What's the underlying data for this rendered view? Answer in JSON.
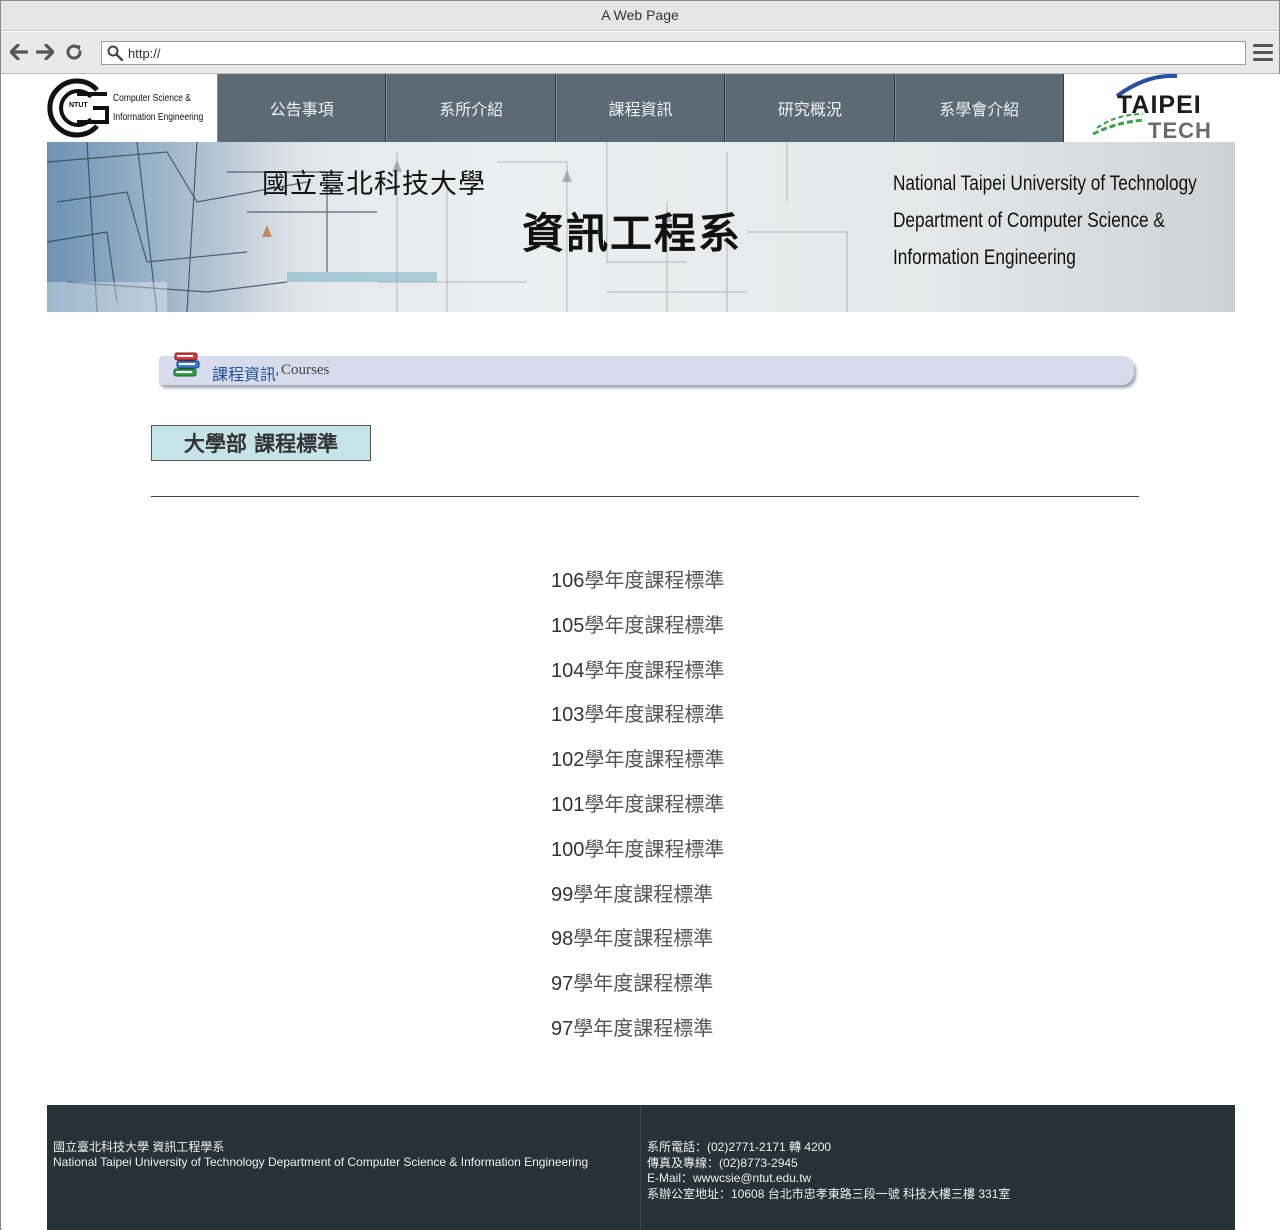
{
  "window": {
    "title": "A Web Page"
  },
  "toolbar": {
    "url": "http://"
  },
  "header": {
    "logo_line1": "Computer Science &",
    "logo_line2": "Information Engineering",
    "logo_badge": "NTUT",
    "nav": [
      "公告事項",
      "系所介紹",
      "課程資訊",
      "研究概況",
      "系學會介紹"
    ],
    "brand_top": "TAIPEI",
    "brand_bottom": "TECH"
  },
  "banner": {
    "univ_cn": "國立臺北科技大學",
    "dept_cn": "資訊工程系",
    "en_line1": "National Taipei University of Technology",
    "en_line2": "Department of Computer Science &",
    "en_line3": "Information Engineering"
  },
  "section": {
    "title_cn": "課程資訊",
    "sep": ",",
    "title_en": "Courses"
  },
  "subtitle": "大學部 課程標準",
  "courses": [
    {
      "year": "106",
      "label": "學年度課程標準"
    },
    {
      "year": "105",
      "label": "學年度課程標準"
    },
    {
      "year": "104",
      "label": "學年度課程標準"
    },
    {
      "year": "103",
      "label": "學年度課程標準"
    },
    {
      "year": "102",
      "label": "學年度課程標準"
    },
    {
      "year": "101",
      "label": "學年度課程標準"
    },
    {
      "year": "100",
      "label": "學年度課程標準"
    },
    {
      "year": "99",
      "label": "學年度課程標準"
    },
    {
      "year": "98",
      "label": "學年度課程標準"
    },
    {
      "year": "97",
      "label": "學年度課程標準"
    },
    {
      "year": "97",
      "label": "學年度課程標準"
    }
  ],
  "footer": {
    "name_cn": "國立臺北科技大學 資訊工程學系",
    "name_en": "National Taipei University of Technology Department of Computer Science & Information Engineering",
    "phone": "系所電話：(02)2771-2171 轉 4200",
    "fax": "傳真及專線：(02)8773-2945",
    "email": "E-Mail：wwwcsie@ntut.edu.tw",
    "address": "系辦公室地址：10608 台北市忠孝東路三段一號 科技大樓三樓 331室"
  },
  "colors": {
    "nav_bg": "#5b6a75",
    "section_bar": "#d6dcec",
    "subtitle_bg": "#c5e4e8",
    "footer_bg": "#263238"
  }
}
